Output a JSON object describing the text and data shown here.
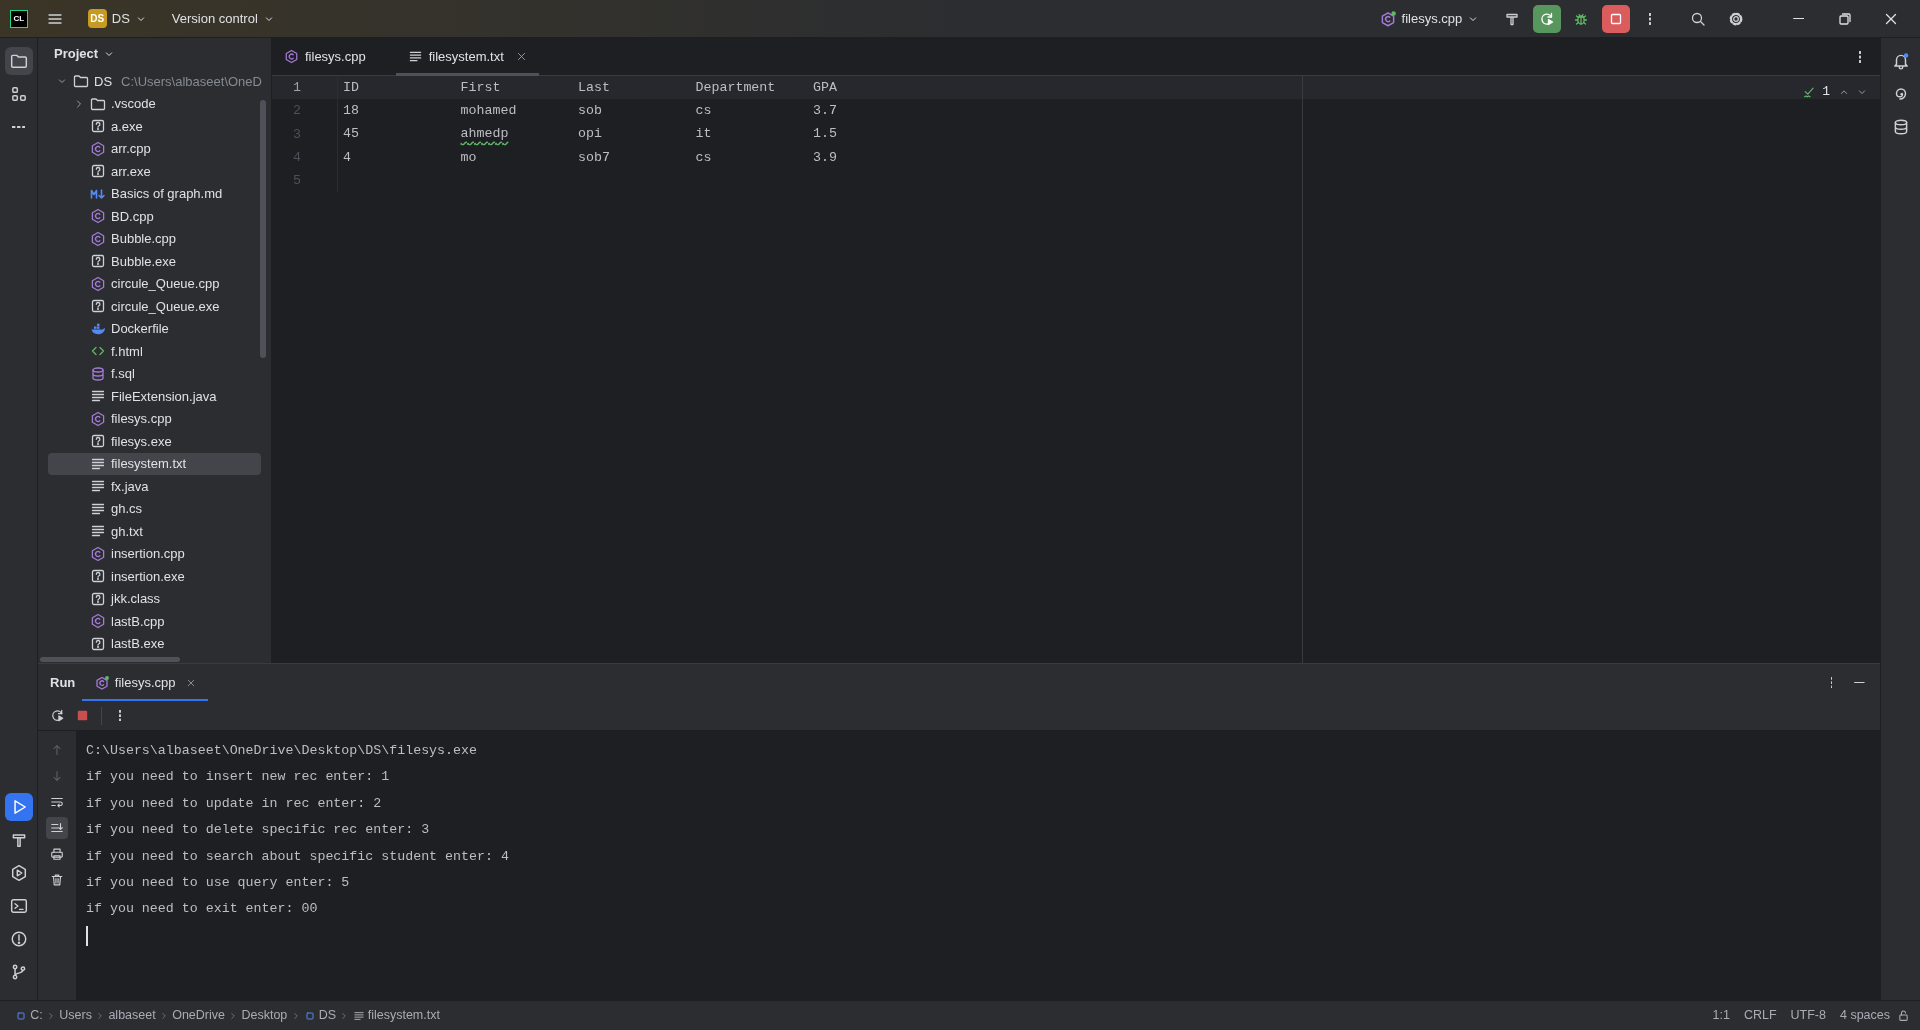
{
  "title_bar": {
    "app_logo": "CL",
    "project_badge": "DS",
    "project_name": "DS",
    "vcs_menu": "Version control",
    "run_config": "filesys.cpp"
  },
  "left_toolbar_top": [
    {
      "kind": "project",
      "selected": true
    },
    {
      "kind": "structure",
      "selected": false
    },
    {
      "kind": "more",
      "selected": false
    }
  ],
  "left_toolbar_bottom": [
    {
      "kind": "run",
      "selected": true
    },
    {
      "kind": "build",
      "selected": false
    },
    {
      "kind": "services",
      "selected": false
    },
    {
      "kind": "terminal",
      "selected": false
    },
    {
      "kind": "problems",
      "selected": false
    },
    {
      "kind": "git",
      "selected": false
    }
  ],
  "right_toolbar": [
    {
      "kind": "notifications",
      "selected": false
    },
    {
      "kind": "assistant",
      "selected": false
    },
    {
      "kind": "database",
      "selected": false
    }
  ],
  "project_panel": {
    "title": "Project",
    "tree": [
      {
        "label": "DS",
        "path": "C:\\Users\\albaseet\\OneD",
        "kind": "folder",
        "expanded": true,
        "selected": false,
        "children": [
          {
            "label": ".vscode",
            "kind": "folder",
            "expanded": false,
            "selected": false
          },
          {
            "label": "a.exe",
            "kind": "exe",
            "selected": false
          },
          {
            "label": "arr.cpp",
            "kind": "cpp",
            "selected": false
          },
          {
            "label": "arr.exe",
            "kind": "exe",
            "selected": false
          },
          {
            "label": "Basics of graph.md",
            "kind": "md",
            "selected": false
          },
          {
            "label": "BD.cpp",
            "kind": "cpp",
            "selected": false
          },
          {
            "label": "Bubble.cpp",
            "kind": "cpp",
            "selected": false
          },
          {
            "label": "Bubble.exe",
            "kind": "exe",
            "selected": false
          },
          {
            "label": "circule_Queue.cpp",
            "kind": "cpp",
            "selected": false
          },
          {
            "label": "circule_Queue.exe",
            "kind": "exe",
            "selected": false
          },
          {
            "label": "Dockerfile",
            "kind": "docker",
            "selected": false
          },
          {
            "label": "f.html",
            "kind": "html",
            "selected": false
          },
          {
            "label": "f.sql",
            "kind": "sql",
            "selected": false
          },
          {
            "label": "FileExtension.java",
            "kind": "text",
            "selected": false
          },
          {
            "label": "filesys.cpp",
            "kind": "cpp",
            "selected": false
          },
          {
            "label": "filesys.exe",
            "kind": "exe",
            "selected": false
          },
          {
            "label": "filesystem.txt",
            "kind": "text",
            "selected": true
          },
          {
            "label": "fx.java",
            "kind": "text",
            "selected": false
          },
          {
            "label": "gh.cs",
            "kind": "text",
            "selected": false
          },
          {
            "label": "gh.txt",
            "kind": "text",
            "selected": false
          },
          {
            "label": "insertion.cpp",
            "kind": "cpp",
            "selected": false
          },
          {
            "label": "insertion.exe",
            "kind": "exe",
            "selected": false
          },
          {
            "label": "jkk.class",
            "kind": "exe",
            "selected": false
          },
          {
            "label": "lastB.cpp",
            "kind": "cpp",
            "selected": false
          },
          {
            "label": "lastB.exe",
            "kind": "exe",
            "selected": false
          }
        ]
      }
    ]
  },
  "editor": {
    "tabs": [
      {
        "label": "filesys.cpp",
        "kind": "cpp",
        "selected": false,
        "closable": false
      },
      {
        "label": "filesystem.txt",
        "kind": "text",
        "selected": true,
        "closable": true
      }
    ],
    "inspection_count": "1",
    "lines": [
      {
        "number": "1",
        "current": true,
        "cells": [
          {
            "text": "ID",
            "misspelled": false
          },
          {
            "text": "First",
            "misspelled": false
          },
          {
            "text": "Last",
            "misspelled": false
          },
          {
            "text": "Department",
            "misspelled": false
          },
          {
            "text": "GPA",
            "misspelled": false
          }
        ]
      },
      {
        "number": "2",
        "current": false,
        "cells": [
          {
            "text": "18",
            "misspelled": false
          },
          {
            "text": "mohamed",
            "misspelled": false
          },
          {
            "text": "sob",
            "misspelled": false
          },
          {
            "text": "cs",
            "misspelled": false
          },
          {
            "text": "3.7",
            "misspelled": false
          }
        ]
      },
      {
        "number": "3",
        "current": false,
        "cells": [
          {
            "text": "45",
            "misspelled": false
          },
          {
            "text": "ahmedp",
            "misspelled": true
          },
          {
            "text": "opi",
            "misspelled": false
          },
          {
            "text": "it",
            "misspelled": false
          },
          {
            "text": "1.5",
            "misspelled": false
          }
        ]
      },
      {
        "number": "4",
        "current": false,
        "cells": [
          {
            "text": "4",
            "misspelled": false
          },
          {
            "text": "mo",
            "misspelled": false
          },
          {
            "text": "sob7",
            "misspelled": false
          },
          {
            "text": "cs",
            "misspelled": false
          },
          {
            "text": "3.9",
            "misspelled": false
          }
        ]
      },
      {
        "number": "5",
        "current": false
      }
    ]
  },
  "run_panel": {
    "title": "Run",
    "tabs": [
      {
        "label": "filesys.cpp",
        "selected": true
      }
    ],
    "gutter_tools": [
      {
        "kind": "up",
        "disabled": true,
        "selected": false
      },
      {
        "kind": "down",
        "disabled": true,
        "selected": false
      },
      {
        "kind": "wrap",
        "disabled": false,
        "selected": false
      },
      {
        "kind": "scroll_end",
        "disabled": false,
        "selected": true
      },
      {
        "kind": "print",
        "disabled": false,
        "selected": false
      },
      {
        "kind": "trash",
        "disabled": false,
        "selected": false
      }
    ],
    "console": [
      "C:\\Users\\albaseet\\OneDrive\\Desktop\\DS\\filesys.exe",
      "if you need to insert new rec enter: 1",
      "if you need to update in rec enter: 2",
      "if you need to delete specific rec enter: 3",
      "if you need to search about specific student enter: 4",
      "if you need to use query enter: 5",
      "if you need to exit enter: 00"
    ]
  },
  "status_bar": {
    "breadcrumbs": [
      {
        "label": "C:",
        "kind": "drive"
      },
      {
        "label": "Users",
        "kind": "folder"
      },
      {
        "label": "albaseet",
        "kind": "folder"
      },
      {
        "label": "OneDrive",
        "kind": "folder"
      },
      {
        "label": "Desktop",
        "kind": "folder"
      },
      {
        "label": "DS",
        "kind": "module"
      },
      {
        "label": "filesystem.txt",
        "kind": "file"
      }
    ],
    "items": [
      "1:1",
      "CRLF",
      "UTF-8",
      "4 spaces"
    ]
  }
}
